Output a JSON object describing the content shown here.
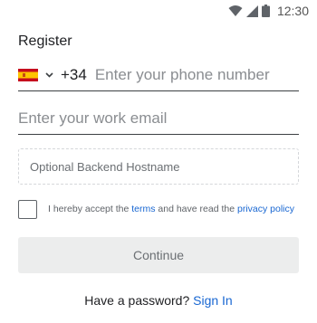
{
  "status_bar": {
    "time": "12:30",
    "icons": [
      "wifi-icon",
      "cell-signal-icon",
      "battery-icon"
    ]
  },
  "form": {
    "title": "Register",
    "phone": {
      "country_flag": "spain-flag-icon",
      "dial_code": "+34",
      "placeholder": "Enter your phone number"
    },
    "email": {
      "placeholder": "Enter your work email"
    },
    "backend_host": {
      "placeholder": "Optional Backend Hostname"
    },
    "terms": {
      "prefix": "I hereby accept the ",
      "terms_link": "terms",
      "middle": " and have read the ",
      "privacy_link": "privacy policy",
      "checked": false
    },
    "continue_label": "Continue",
    "signin": {
      "prompt": "Have a password? ",
      "link": "Sign In"
    }
  },
  "colors": {
    "link": "#1967d2",
    "button_bg": "#eceded",
    "placeholder": "#8a8d91"
  }
}
